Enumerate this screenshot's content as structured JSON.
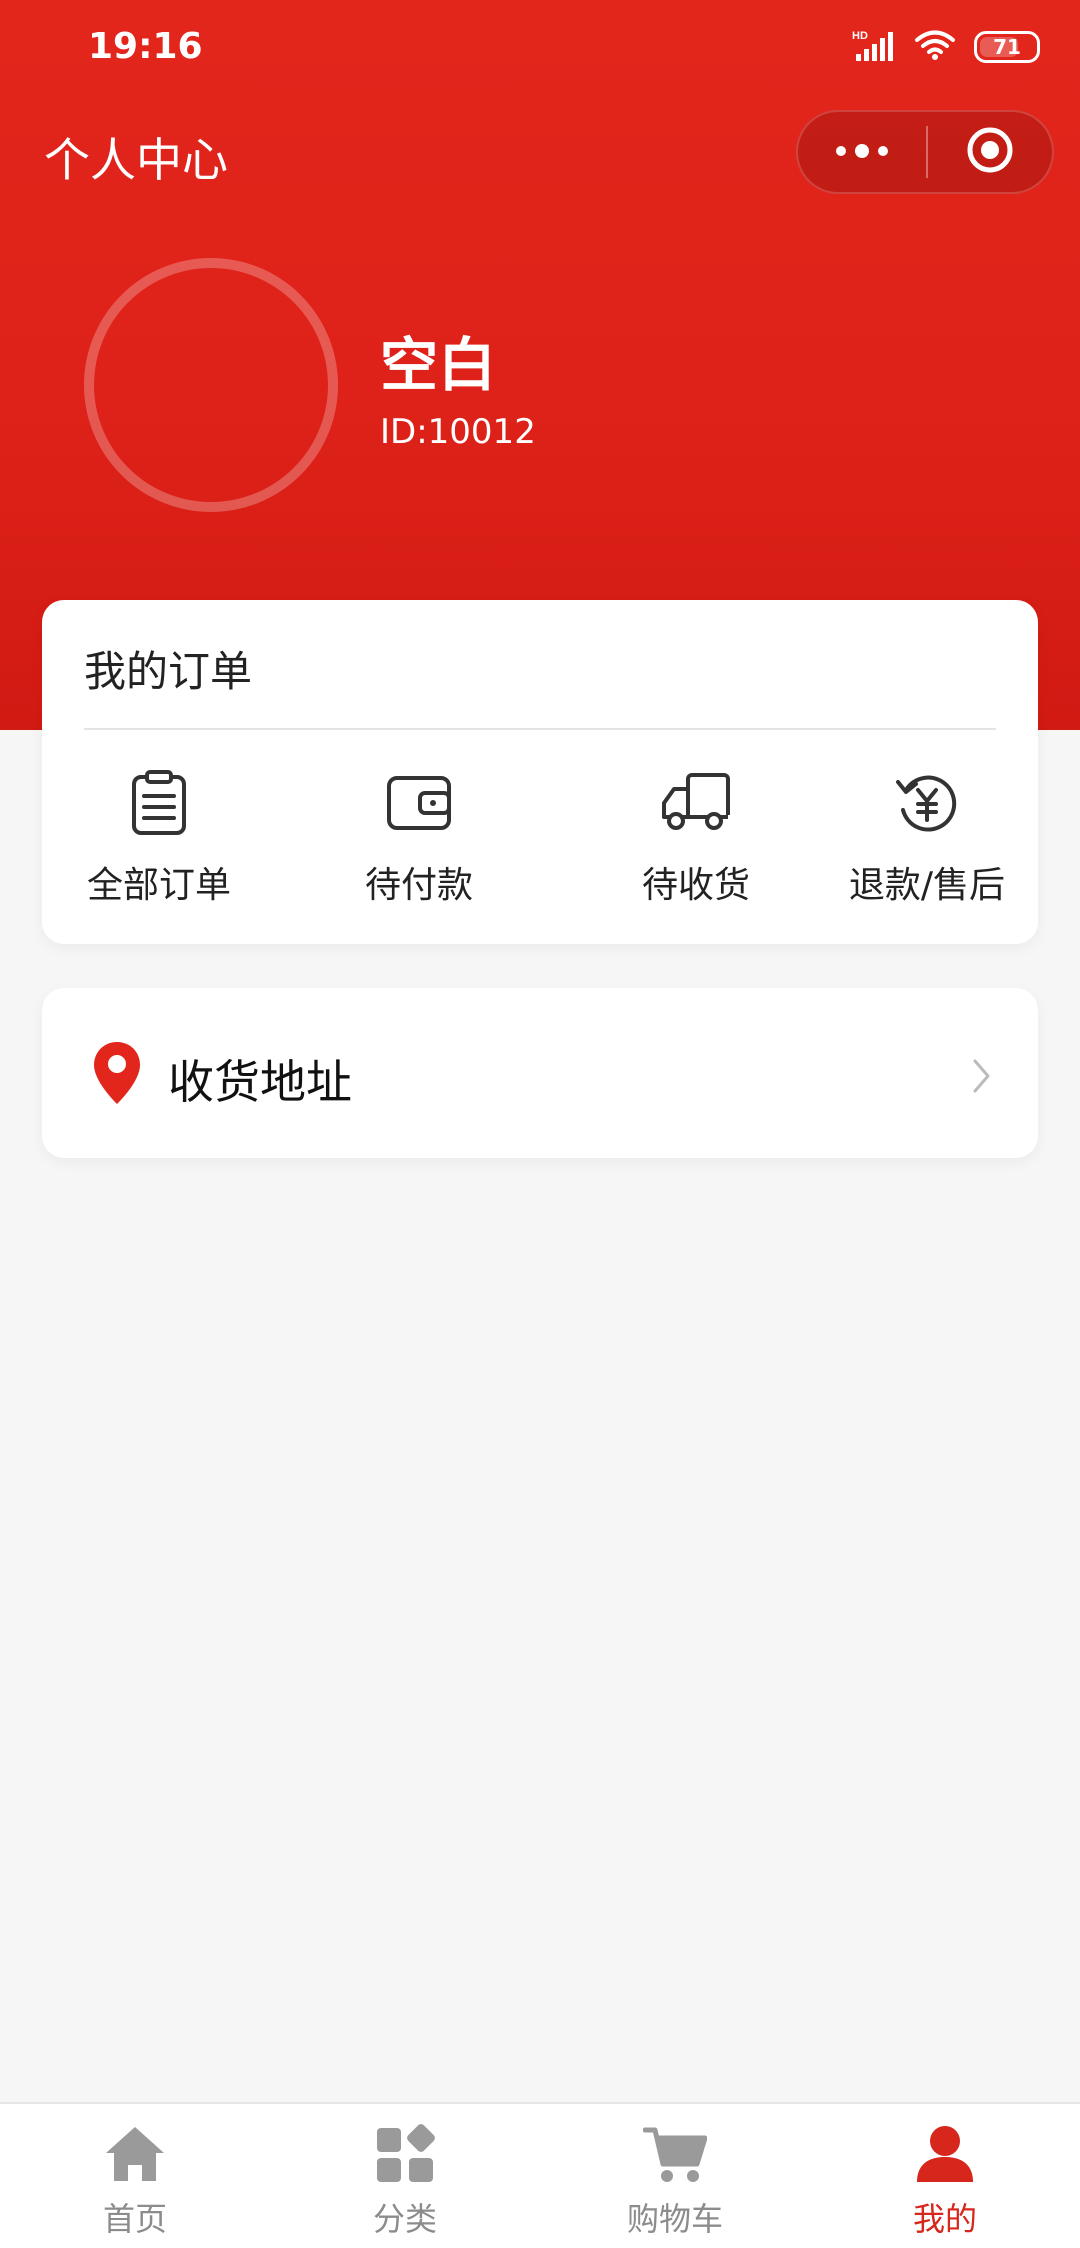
{
  "status_bar": {
    "time": "19:16",
    "network_label": "HD",
    "battery": "71",
    "battery_level": 0.71
  },
  "header": {
    "title": "个人中心",
    "more_icon": "more-dots-icon",
    "close_icon": "target-circle-icon"
  },
  "profile": {
    "name": "空白",
    "id_text": "ID:10012"
  },
  "orders": {
    "title": "我的订单",
    "items": [
      {
        "label": "全部订单",
        "icon": "clipboard-icon"
      },
      {
        "label": "待付款",
        "icon": "wallet-icon"
      },
      {
        "label": "待收货",
        "icon": "truck-icon"
      },
      {
        "label": "退款/售后",
        "icon": "refund-yen-icon"
      }
    ]
  },
  "address": {
    "label": "收货地址",
    "icon": "location-pin-icon"
  },
  "tabbar": {
    "items": [
      {
        "label": "首页",
        "icon": "home-icon"
      },
      {
        "label": "分类",
        "icon": "category-icon"
      },
      {
        "label": "购物车",
        "icon": "cart-icon"
      },
      {
        "label": "我的",
        "icon": "user-icon"
      }
    ],
    "active_index": 3
  },
  "colors": {
    "brand": "#e2261c",
    "active_tab": "#d7261c",
    "inactive_tab": "#8c8c8c",
    "background": "#f6f6f6"
  }
}
